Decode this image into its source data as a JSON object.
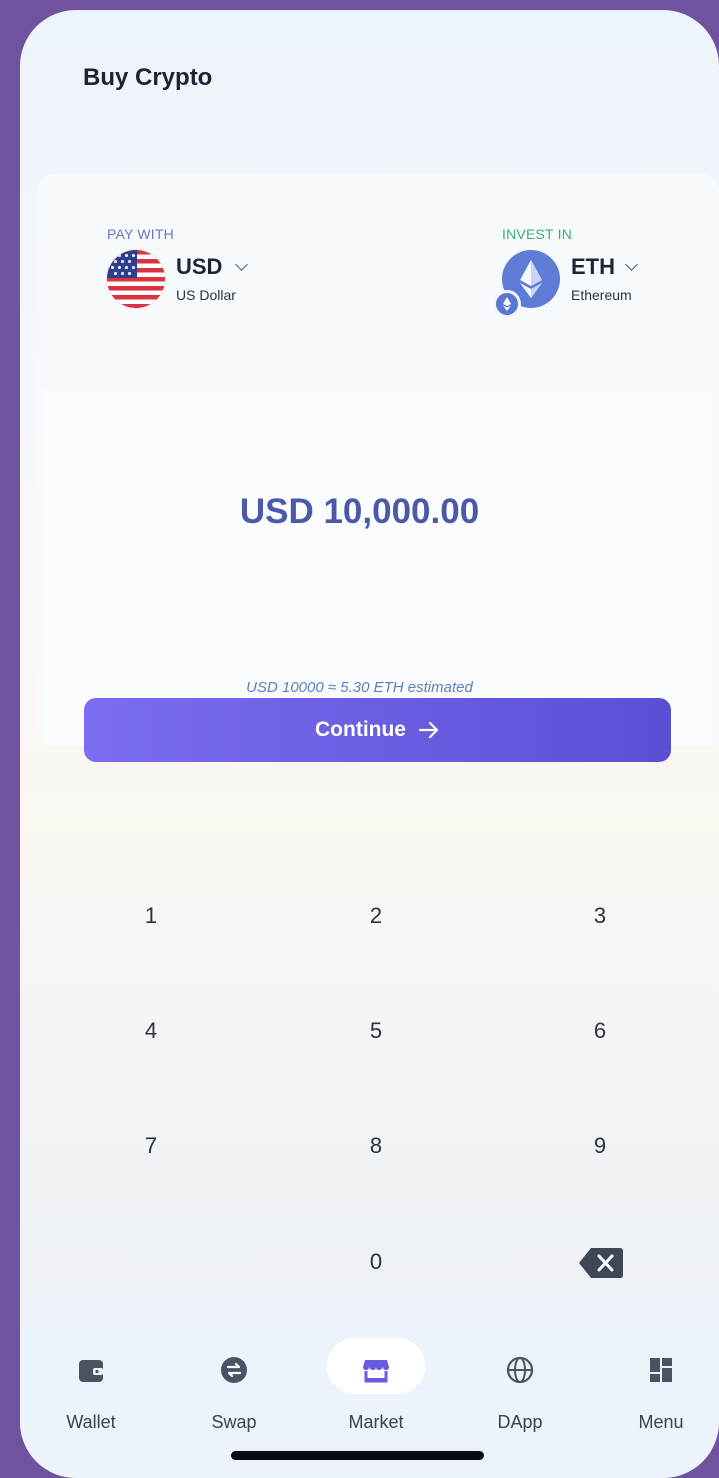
{
  "header": {
    "title": "Buy Crypto"
  },
  "pay_with": {
    "label": "PAY WITH",
    "code": "USD",
    "name": "US Dollar",
    "icon": "us-flag-icon"
  },
  "invest_in": {
    "label": "INVEST IN",
    "code": "ETH",
    "name": "Ethereum",
    "icon": "ethereum-icon"
  },
  "amount": {
    "display": "USD 10,000.00"
  },
  "estimate": {
    "text": "USD 10000 ≈ 5.30 ETH estimated"
  },
  "continue_button": {
    "label": "Continue",
    "icon": "arrow-right-icon"
  },
  "keypad": {
    "keys": [
      "1",
      "2",
      "3",
      "4",
      "5",
      "6",
      "7",
      "8",
      "9",
      "0"
    ],
    "backspace_icon": "backspace-icon"
  },
  "tabbar": {
    "items": [
      {
        "label": "Wallet",
        "icon": "wallet-icon"
      },
      {
        "label": "Swap",
        "icon": "swap-icon"
      },
      {
        "label": "Market",
        "icon": "market-store-icon",
        "active": true
      },
      {
        "label": "DApp",
        "icon": "globe-icon"
      },
      {
        "label": "Menu",
        "icon": "dashboard-grid-icon"
      }
    ]
  },
  "colors": {
    "background": "#6f52a0",
    "accent": "#6a5ce0",
    "pay_label": "#6c74c9",
    "invest_label": "#3fae6a",
    "amount_text": "#4a5aa8"
  }
}
